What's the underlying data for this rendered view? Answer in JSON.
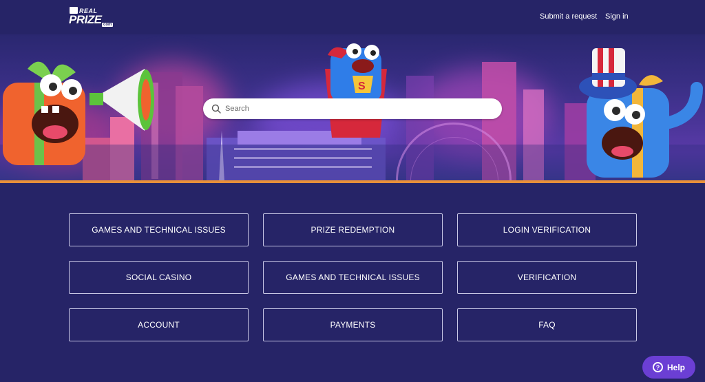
{
  "header": {
    "logo": {
      "alt": "Real Prize",
      "text_top": "REAL",
      "text_main": "PRIZE",
      "text_suffix": "com"
    },
    "nav": [
      {
        "label": "Submit a request"
      },
      {
        "label": "Sign in"
      }
    ]
  },
  "hero": {
    "search": {
      "placeholder": "Search",
      "value": "",
      "icon": "search-icon"
    }
  },
  "categories": [
    {
      "label": "GAMES AND TECHNICAL ISSUES"
    },
    {
      "label": "PRIZE REDEMPTION"
    },
    {
      "label": "LOGIN VERIFICATION"
    },
    {
      "label": "SOCIAL CASINO"
    },
    {
      "label": "GAMES AND TECHNICAL ISSUES"
    },
    {
      "label": "VERIFICATION"
    },
    {
      "label": "ACCOUNT"
    },
    {
      "label": "PAYMENTS"
    },
    {
      "label": "FAQ"
    }
  ],
  "help_widget": {
    "label": "Help",
    "icon": "question-icon"
  },
  "colors": {
    "background": "#262467",
    "accent_border": "#e8903a",
    "help_button": "#6b3fd4",
    "tile_border": "#c9c8e6"
  }
}
